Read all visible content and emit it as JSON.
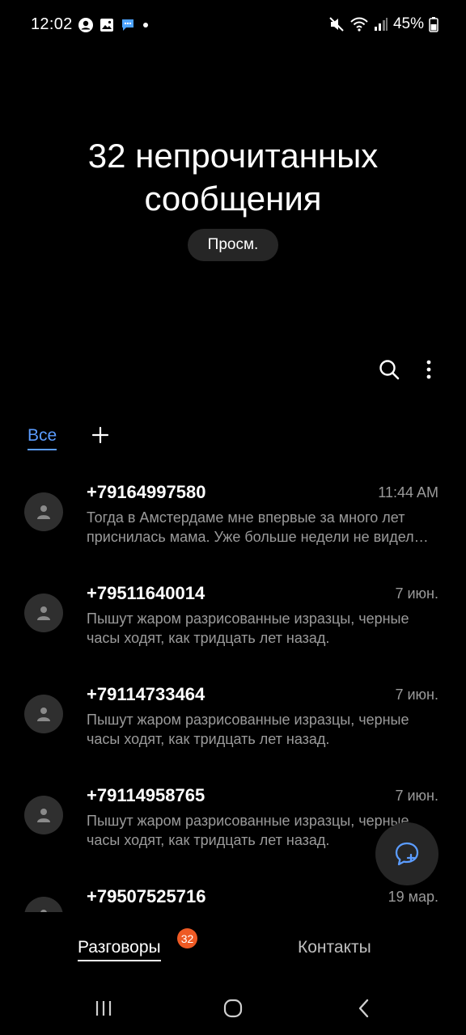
{
  "status_bar": {
    "time": "12:02",
    "battery": "45%",
    "left_icons": [
      "account-circle-icon",
      "image-icon",
      "chat-bubble-icon",
      "dot-icon"
    ],
    "right_icons": [
      "mute-icon",
      "wifi-icon",
      "signal-icon",
      "battery-icon"
    ]
  },
  "header": {
    "title_line1": "32 непрочитанных",
    "title_line2": "сообщения",
    "view_button": "Просм."
  },
  "toolbar": {
    "search_icon": "search-icon",
    "more_icon": "more-vert-icon"
  },
  "tabs": {
    "all_label": "Все",
    "add_icon": "plus-icon"
  },
  "conversations": [
    {
      "name": "+79164997580",
      "time": "11:44 AM",
      "preview": "Тогда в Амстердаме мне впервые за много лет приснилась мама. Уже больше недели не видела её во сне."
    },
    {
      "name": "+79511640014",
      "time": "7 июн.",
      "preview": "Пышут жаром разрисованные изразцы, черные часы ходят, как тридцать  лет назад."
    },
    {
      "name": "+79114733464",
      "time": "7 июн.",
      "preview": "Пышут жаром разрисованные изразцы, черные часы ходят, как тридцать  лет назад."
    },
    {
      "name": "+79114958765",
      "time": "7 июн.",
      "preview": "Пышут жаром разрисованные изразцы, черные часы ходят, как тридцать  лет назад."
    },
    {
      "name": "+79507525716",
      "time": "19 мар.",
      "preview": ""
    }
  ],
  "fab": {
    "icon": "new-message-icon"
  },
  "bottom_nav": {
    "conversations_label": "Разговоры",
    "badge": "32",
    "contacts_label": "Контакты"
  },
  "colors": {
    "accent": "#5b9cff",
    "badge": "#ee5a24",
    "secondary_text": "#9a9a9a",
    "surface": "#262626"
  }
}
